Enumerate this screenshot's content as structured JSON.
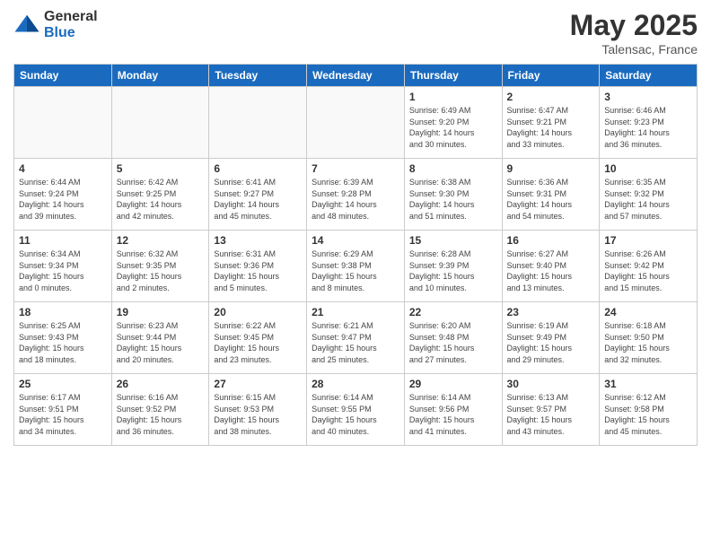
{
  "header": {
    "logo_general": "General",
    "logo_blue": "Blue",
    "month": "May 2025",
    "location": "Talensac, France"
  },
  "weekdays": [
    "Sunday",
    "Monday",
    "Tuesday",
    "Wednesday",
    "Thursday",
    "Friday",
    "Saturday"
  ],
  "weeks": [
    [
      {
        "day": "",
        "info": ""
      },
      {
        "day": "",
        "info": ""
      },
      {
        "day": "",
        "info": ""
      },
      {
        "day": "",
        "info": ""
      },
      {
        "day": "1",
        "info": "Sunrise: 6:49 AM\nSunset: 9:20 PM\nDaylight: 14 hours\nand 30 minutes."
      },
      {
        "day": "2",
        "info": "Sunrise: 6:47 AM\nSunset: 9:21 PM\nDaylight: 14 hours\nand 33 minutes."
      },
      {
        "day": "3",
        "info": "Sunrise: 6:46 AM\nSunset: 9:23 PM\nDaylight: 14 hours\nand 36 minutes."
      }
    ],
    [
      {
        "day": "4",
        "info": "Sunrise: 6:44 AM\nSunset: 9:24 PM\nDaylight: 14 hours\nand 39 minutes."
      },
      {
        "day": "5",
        "info": "Sunrise: 6:42 AM\nSunset: 9:25 PM\nDaylight: 14 hours\nand 42 minutes."
      },
      {
        "day": "6",
        "info": "Sunrise: 6:41 AM\nSunset: 9:27 PM\nDaylight: 14 hours\nand 45 minutes."
      },
      {
        "day": "7",
        "info": "Sunrise: 6:39 AM\nSunset: 9:28 PM\nDaylight: 14 hours\nand 48 minutes."
      },
      {
        "day": "8",
        "info": "Sunrise: 6:38 AM\nSunset: 9:30 PM\nDaylight: 14 hours\nand 51 minutes."
      },
      {
        "day": "9",
        "info": "Sunrise: 6:36 AM\nSunset: 9:31 PM\nDaylight: 14 hours\nand 54 minutes."
      },
      {
        "day": "10",
        "info": "Sunrise: 6:35 AM\nSunset: 9:32 PM\nDaylight: 14 hours\nand 57 minutes."
      }
    ],
    [
      {
        "day": "11",
        "info": "Sunrise: 6:34 AM\nSunset: 9:34 PM\nDaylight: 15 hours\nand 0 minutes."
      },
      {
        "day": "12",
        "info": "Sunrise: 6:32 AM\nSunset: 9:35 PM\nDaylight: 15 hours\nand 2 minutes."
      },
      {
        "day": "13",
        "info": "Sunrise: 6:31 AM\nSunset: 9:36 PM\nDaylight: 15 hours\nand 5 minutes."
      },
      {
        "day": "14",
        "info": "Sunrise: 6:29 AM\nSunset: 9:38 PM\nDaylight: 15 hours\nand 8 minutes."
      },
      {
        "day": "15",
        "info": "Sunrise: 6:28 AM\nSunset: 9:39 PM\nDaylight: 15 hours\nand 10 minutes."
      },
      {
        "day": "16",
        "info": "Sunrise: 6:27 AM\nSunset: 9:40 PM\nDaylight: 15 hours\nand 13 minutes."
      },
      {
        "day": "17",
        "info": "Sunrise: 6:26 AM\nSunset: 9:42 PM\nDaylight: 15 hours\nand 15 minutes."
      }
    ],
    [
      {
        "day": "18",
        "info": "Sunrise: 6:25 AM\nSunset: 9:43 PM\nDaylight: 15 hours\nand 18 minutes."
      },
      {
        "day": "19",
        "info": "Sunrise: 6:23 AM\nSunset: 9:44 PM\nDaylight: 15 hours\nand 20 minutes."
      },
      {
        "day": "20",
        "info": "Sunrise: 6:22 AM\nSunset: 9:45 PM\nDaylight: 15 hours\nand 23 minutes."
      },
      {
        "day": "21",
        "info": "Sunrise: 6:21 AM\nSunset: 9:47 PM\nDaylight: 15 hours\nand 25 minutes."
      },
      {
        "day": "22",
        "info": "Sunrise: 6:20 AM\nSunset: 9:48 PM\nDaylight: 15 hours\nand 27 minutes."
      },
      {
        "day": "23",
        "info": "Sunrise: 6:19 AM\nSunset: 9:49 PM\nDaylight: 15 hours\nand 29 minutes."
      },
      {
        "day": "24",
        "info": "Sunrise: 6:18 AM\nSunset: 9:50 PM\nDaylight: 15 hours\nand 32 minutes."
      }
    ],
    [
      {
        "day": "25",
        "info": "Sunrise: 6:17 AM\nSunset: 9:51 PM\nDaylight: 15 hours\nand 34 minutes."
      },
      {
        "day": "26",
        "info": "Sunrise: 6:16 AM\nSunset: 9:52 PM\nDaylight: 15 hours\nand 36 minutes."
      },
      {
        "day": "27",
        "info": "Sunrise: 6:15 AM\nSunset: 9:53 PM\nDaylight: 15 hours\nand 38 minutes."
      },
      {
        "day": "28",
        "info": "Sunrise: 6:14 AM\nSunset: 9:55 PM\nDaylight: 15 hours\nand 40 minutes."
      },
      {
        "day": "29",
        "info": "Sunrise: 6:14 AM\nSunset: 9:56 PM\nDaylight: 15 hours\nand 41 minutes."
      },
      {
        "day": "30",
        "info": "Sunrise: 6:13 AM\nSunset: 9:57 PM\nDaylight: 15 hours\nand 43 minutes."
      },
      {
        "day": "31",
        "info": "Sunrise: 6:12 AM\nSunset: 9:58 PM\nDaylight: 15 hours\nand 45 minutes."
      }
    ]
  ]
}
